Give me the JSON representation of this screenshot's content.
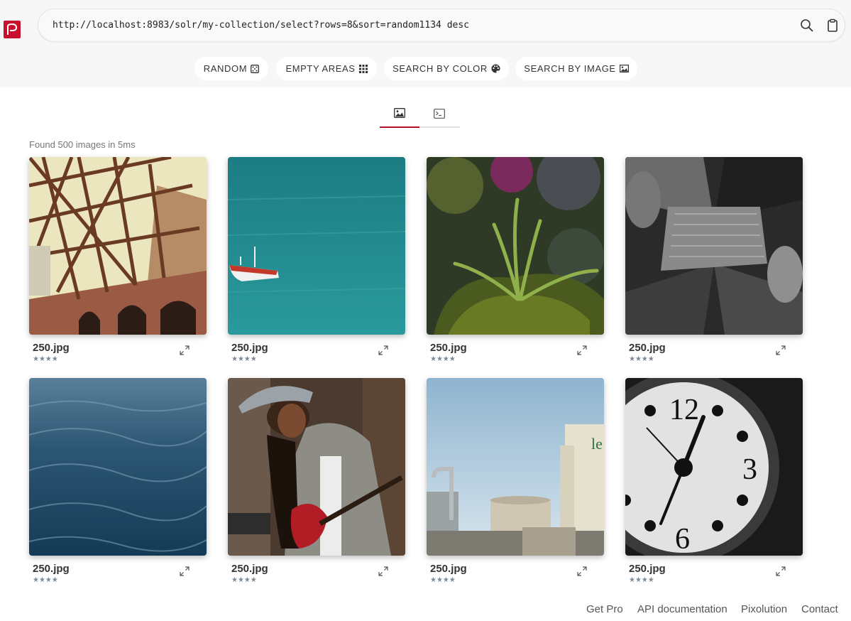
{
  "header": {
    "query": "http://localhost:8983/solr/my-collection/select?rows=8&sort=random1134 desc"
  },
  "buttons": {
    "random": "RANDOM",
    "empty_areas": "EMPTY AREAS",
    "search_by_color": "SEARCH BY COLOR",
    "search_by_image": "SEARCH BY IMAGE"
  },
  "results": {
    "summary": "Found 500 images in 5ms",
    "items": [
      {
        "filename": "250.jpg",
        "stars": "★★★★"
      },
      {
        "filename": "250.jpg",
        "stars": "★★★★"
      },
      {
        "filename": "250.jpg",
        "stars": "★★★★"
      },
      {
        "filename": "250.jpg",
        "stars": "★★★★"
      },
      {
        "filename": "250.jpg",
        "stars": "★★★★"
      },
      {
        "filename": "250.jpg",
        "stars": "★★★★"
      },
      {
        "filename": "250.jpg",
        "stars": "★★★★"
      },
      {
        "filename": "250.jpg",
        "stars": "★★★★"
      }
    ]
  },
  "footer": {
    "get_pro": "Get Pro",
    "api_docs": "API documentation",
    "pixolution": "Pixolution",
    "contact": "Contact"
  },
  "colors": {
    "brand": "#c8102e",
    "active_tab": "#b0102a"
  },
  "icons": [
    "logo-icon",
    "search-icon",
    "clipboard-icon",
    "dice-icon",
    "grid-icon",
    "palette-icon",
    "image-icon",
    "terminal-icon",
    "expand-icon"
  ]
}
